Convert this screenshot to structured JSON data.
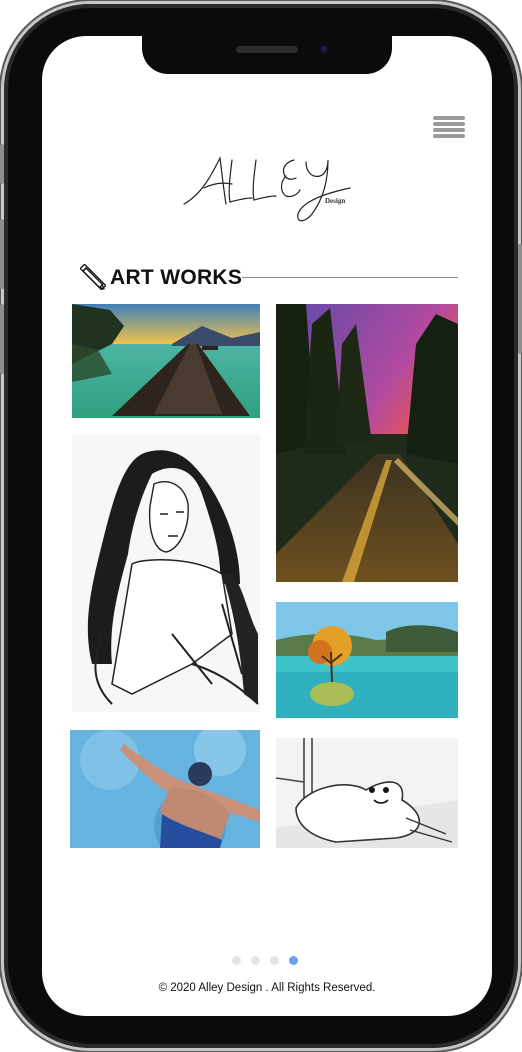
{
  "brand": {
    "logo_script": "ALLEY",
    "logo_sub": "Design"
  },
  "section": {
    "title": "ART WORKS",
    "icon": "pencil-ruler-icon"
  },
  "gallery": [
    {
      "name": "lake-dock-painting"
    },
    {
      "name": "forest-road-sunset-painting"
    },
    {
      "name": "woman-ink-sketch"
    },
    {
      "name": "autumn-tree-lake-painting"
    },
    {
      "name": "swimmer-painting"
    },
    {
      "name": "dog-sketch"
    }
  ],
  "carousel": {
    "total": 4,
    "active": 4
  },
  "footer": {
    "copyright": "© 2020 Alley Design . All Rights Reserved."
  },
  "colors": {
    "accent_dot": "#6aa2e6",
    "inactive_dot": "#e4e4e4",
    "phone_frame": "#0b0b0b"
  }
}
